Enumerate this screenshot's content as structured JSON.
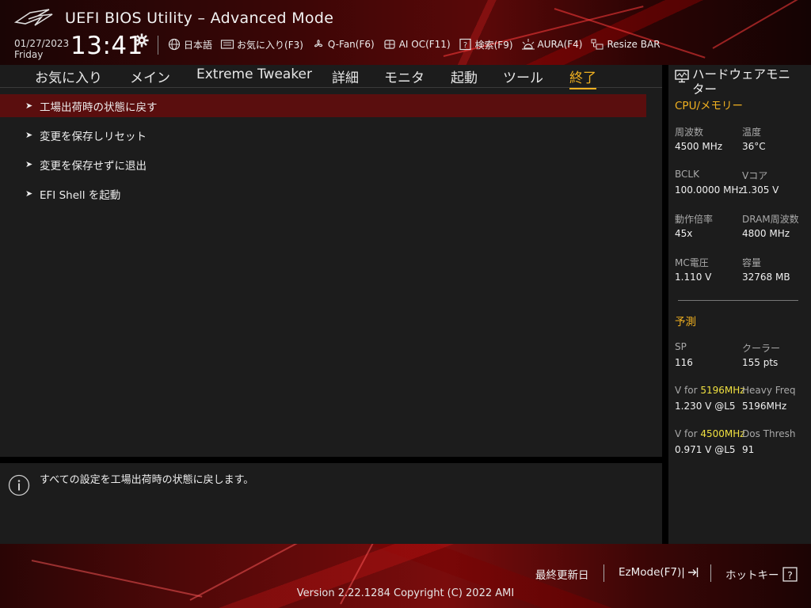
{
  "header": {
    "app_title": "UEFI BIOS Utility – Advanced Mode",
    "date": "01/27/2023",
    "day": "Friday",
    "time": "13:41",
    "toolbar": [
      {
        "label": "日本語",
        "icon": "globe-icon"
      },
      {
        "label": "お気に入り(F3)",
        "icon": "favorites-icon"
      },
      {
        "label": "Q-Fan(F6)",
        "icon": "fan-icon"
      },
      {
        "label": "AI OC(F11)",
        "icon": "ai-oc-icon"
      },
      {
        "label": "検索(F9)",
        "icon": "search-help-icon"
      },
      {
        "label": "AURA(F4)",
        "icon": "aura-icon"
      },
      {
        "label": "Resize BAR",
        "icon": "resize-bar-icon"
      }
    ]
  },
  "menu": {
    "tabs": [
      "お気に入り",
      "メイン",
      "Extreme Tweaker",
      "詳細",
      "モニタ",
      "起動",
      "ツール",
      "終了"
    ],
    "active_tab": "終了",
    "items": [
      {
        "label": "工場出荷時の状態に戻す",
        "selected": true
      },
      {
        "label": "変更を保存しリセット",
        "selected": false
      },
      {
        "label": "変更を保存せずに退出",
        "selected": false
      },
      {
        "label": "EFI Shell を起動",
        "selected": false
      }
    ]
  },
  "help": {
    "text": "すべての設定を工場出荷時の状態に戻します。"
  },
  "hw_monitor": {
    "title_line1": "ハードウェアモニ",
    "title_line2": "ター",
    "cpu_section": "CPU/メモリー",
    "cpu": {
      "freq_label": "周波数",
      "freq_value": "4500 MHz",
      "temp_label": "温度",
      "temp_value": "36°C",
      "bclk_label": "BCLK",
      "bclk_value": "100.0000 MHz",
      "vcore_label": "Vコア",
      "vcore_value": "1.305 V",
      "ratio_label": "動作倍率",
      "ratio_value": "45x",
      "dram_label": "DRAM周波数",
      "dram_value": "4800 MHz",
      "mc_label": "MC電圧",
      "mc_value": "1.110 V",
      "cap_label": "容量",
      "cap_value": "32768 MB"
    },
    "prediction_section": "予測",
    "prediction": {
      "sp_label": "SP",
      "sp_value": "116",
      "cooler_label": "クーラー",
      "cooler_value": "155 pts",
      "v1_prefix": "V for ",
      "v1_freq": "5196MHz",
      "v1_value": "1.230 V @L5",
      "heavy_label": "Heavy Freq",
      "heavy_value": "5196MHz",
      "v2_prefix": "V for ",
      "v2_freq": "4500MHz",
      "v2_value": "0.971 V @L5",
      "dos_label": "Dos Thresh",
      "dos_value": "91"
    }
  },
  "footer": {
    "last_modified": "最終更新日",
    "ezmode": "EzMode(F7)|",
    "hotkeys": "ホットキー",
    "version": "Version 2.22.1284 Copyright (C) 2022 AMI"
  },
  "colors": {
    "accent": "#f0b020",
    "highlight": "#f0e040",
    "selected_row": "#5a0e0e",
    "panel": "#1c1c1c"
  }
}
